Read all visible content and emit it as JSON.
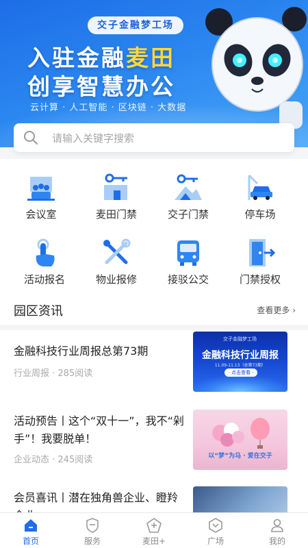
{
  "banner": {
    "brand": "交子金融梦工场",
    "headline_pre": "入驻金融",
    "headline_accent": "麦田",
    "headline2": "创享智慧办公",
    "tagline": "云计算 · 人工智能 · 区块链 · 大数据"
  },
  "search": {
    "placeholder": "请输入关键字搜索"
  },
  "services": [
    {
      "label": "会议室",
      "icon": "meeting-room-icon"
    },
    {
      "label": "麦田门禁",
      "icon": "key-door-icon"
    },
    {
      "label": "交子门禁",
      "icon": "key-mountain-icon"
    },
    {
      "label": "停车场",
      "icon": "car-icon"
    },
    {
      "label": "活动报名",
      "icon": "hand-tap-icon"
    },
    {
      "label": "物业报修",
      "icon": "tools-icon"
    },
    {
      "label": "接驳公交",
      "icon": "bus-icon"
    },
    {
      "label": "门禁授权",
      "icon": "door-auth-icon"
    }
  ],
  "news": {
    "title": "园区资讯",
    "more": "查看更多",
    "articles": [
      {
        "title": "金融科技行业周报总第73期",
        "meta": "行业周报 · 285阅读",
        "thumb_small": "交子金融梦工场",
        "thumb_main": "金融科技行业周报",
        "thumb_date": "11.09-11.13（总第73期）",
        "thumb_btn": "· 点击查看 ·"
      },
      {
        "title": "活动预告丨这个“双十一”，我不“剁手”！我要脱单！",
        "meta": "企业动态 · 245阅读",
        "thumb_slogan": "以“梦”为马 · 爱在交子"
      },
      {
        "title": "会员喜讯丨潜在独角兽企业、瞪羚企业、..."
      }
    ]
  },
  "tabbar": [
    {
      "label": "首页",
      "icon": "home-icon",
      "active": true
    },
    {
      "label": "服务",
      "icon": "service-shield-icon",
      "active": false
    },
    {
      "label": "麦田+",
      "icon": "maitian-plus-icon",
      "active": false
    },
    {
      "label": "广场",
      "icon": "plaza-icon",
      "active": false
    },
    {
      "label": "我的",
      "icon": "user-icon",
      "active": false
    }
  ],
  "colors": {
    "primary": "#1f6ee8",
    "accent": "#ffd83a",
    "text": "#222222",
    "muted": "#a9a9a9"
  }
}
